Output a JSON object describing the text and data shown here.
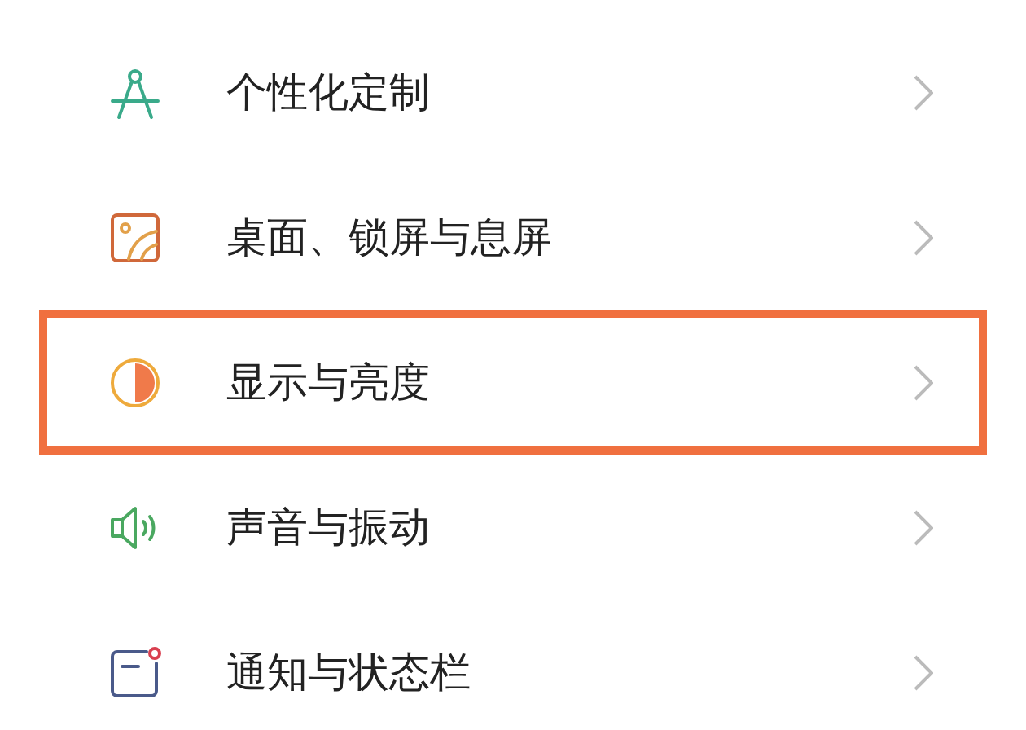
{
  "settings_items": [
    {
      "kind": "compass",
      "label": "个性化定制",
      "highlighted": false
    },
    {
      "kind": "wallpaper",
      "label": "桌面、锁屏与息屏",
      "highlighted": false
    },
    {
      "kind": "display",
      "label": "显示与亮度",
      "highlighted": true
    },
    {
      "kind": "sound",
      "label": "声音与振动",
      "highlighted": false
    },
    {
      "kind": "notification",
      "label": "通知与状态栏",
      "highlighted": false
    }
  ]
}
